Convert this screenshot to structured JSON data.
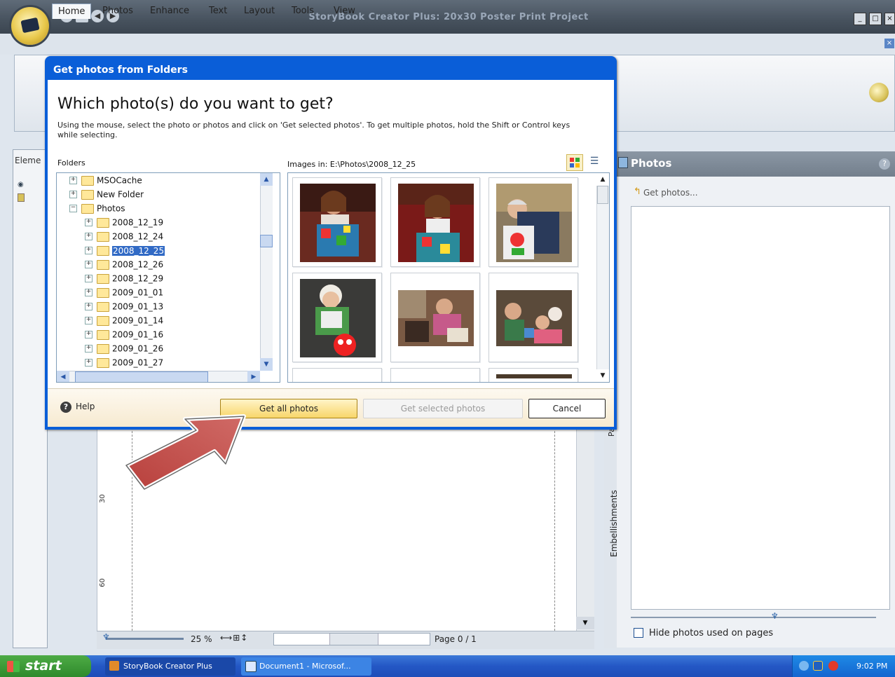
{
  "app": {
    "title": "StoryBook Creator Plus: 20x30 Poster Print Project",
    "ribbon_tabs": [
      "Home",
      "Photos",
      "Enhance",
      "Text",
      "Layout",
      "Tools",
      "View"
    ]
  },
  "left_panel": {
    "label": "Eleme"
  },
  "canvas": {
    "ruler_labels": [
      "30",
      "60"
    ],
    "zoom": "25 %",
    "zoom_icons": "⟷⊞↕",
    "page_indicator": "Page 0 / 1"
  },
  "side_tabs": {
    "pages": "Pa",
    "embellishments": "Embellishments"
  },
  "photos_panel": {
    "title": "Photos",
    "get_photos": "Get photos...",
    "hide_label": "Hide photos used on pages"
  },
  "dialog": {
    "title": "Get photos from Folders",
    "heading": "Which photo(s) do you want to get?",
    "instructions": "Using the mouse, select the photo or photos and click on 'Get selected photos'.  To get multiple photos, hold the Shift or Control keys while selecting.",
    "folders_label": "Folders",
    "images_label": "Images in: E:\\Photos\\2008_12_25",
    "folders": [
      {
        "name": "MSOCache",
        "level": 1,
        "exp": "+"
      },
      {
        "name": "New Folder",
        "level": 1,
        "exp": "+"
      },
      {
        "name": "Photos",
        "level": 1,
        "exp": "−"
      },
      {
        "name": "2008_12_19",
        "level": 2,
        "exp": "+"
      },
      {
        "name": "2008_12_24",
        "level": 2,
        "exp": "+"
      },
      {
        "name": "2008_12_25",
        "level": 2,
        "exp": "+",
        "selected": true
      },
      {
        "name": "2008_12_26",
        "level": 2,
        "exp": "+"
      },
      {
        "name": "2008_12_29",
        "level": 2,
        "exp": "+"
      },
      {
        "name": "2009_01_01",
        "level": 2,
        "exp": "+"
      },
      {
        "name": "2009_01_13",
        "level": 2,
        "exp": "+"
      },
      {
        "name": "2009_01_14",
        "level": 2,
        "exp": "+"
      },
      {
        "name": "2009_01_16",
        "level": 2,
        "exp": "+"
      },
      {
        "name": "2009_01_26",
        "level": 2,
        "exp": "+"
      },
      {
        "name": "2009_01_27",
        "level": 2,
        "exp": "+"
      }
    ],
    "help_label": "Help",
    "buttons": {
      "get_all": "Get all photos",
      "get_selected": "Get selected photos",
      "cancel": "Cancel"
    }
  },
  "taskbar": {
    "start": "start",
    "tasks": [
      "StoryBook Creator Plus",
      "Document1 - Microsof..."
    ],
    "clock": "9:02 PM"
  },
  "colors": {
    "dialog_blue": "#0a5ed8",
    "arrow_red": "#c0504d",
    "accent_yellow": "#f8d66a"
  }
}
